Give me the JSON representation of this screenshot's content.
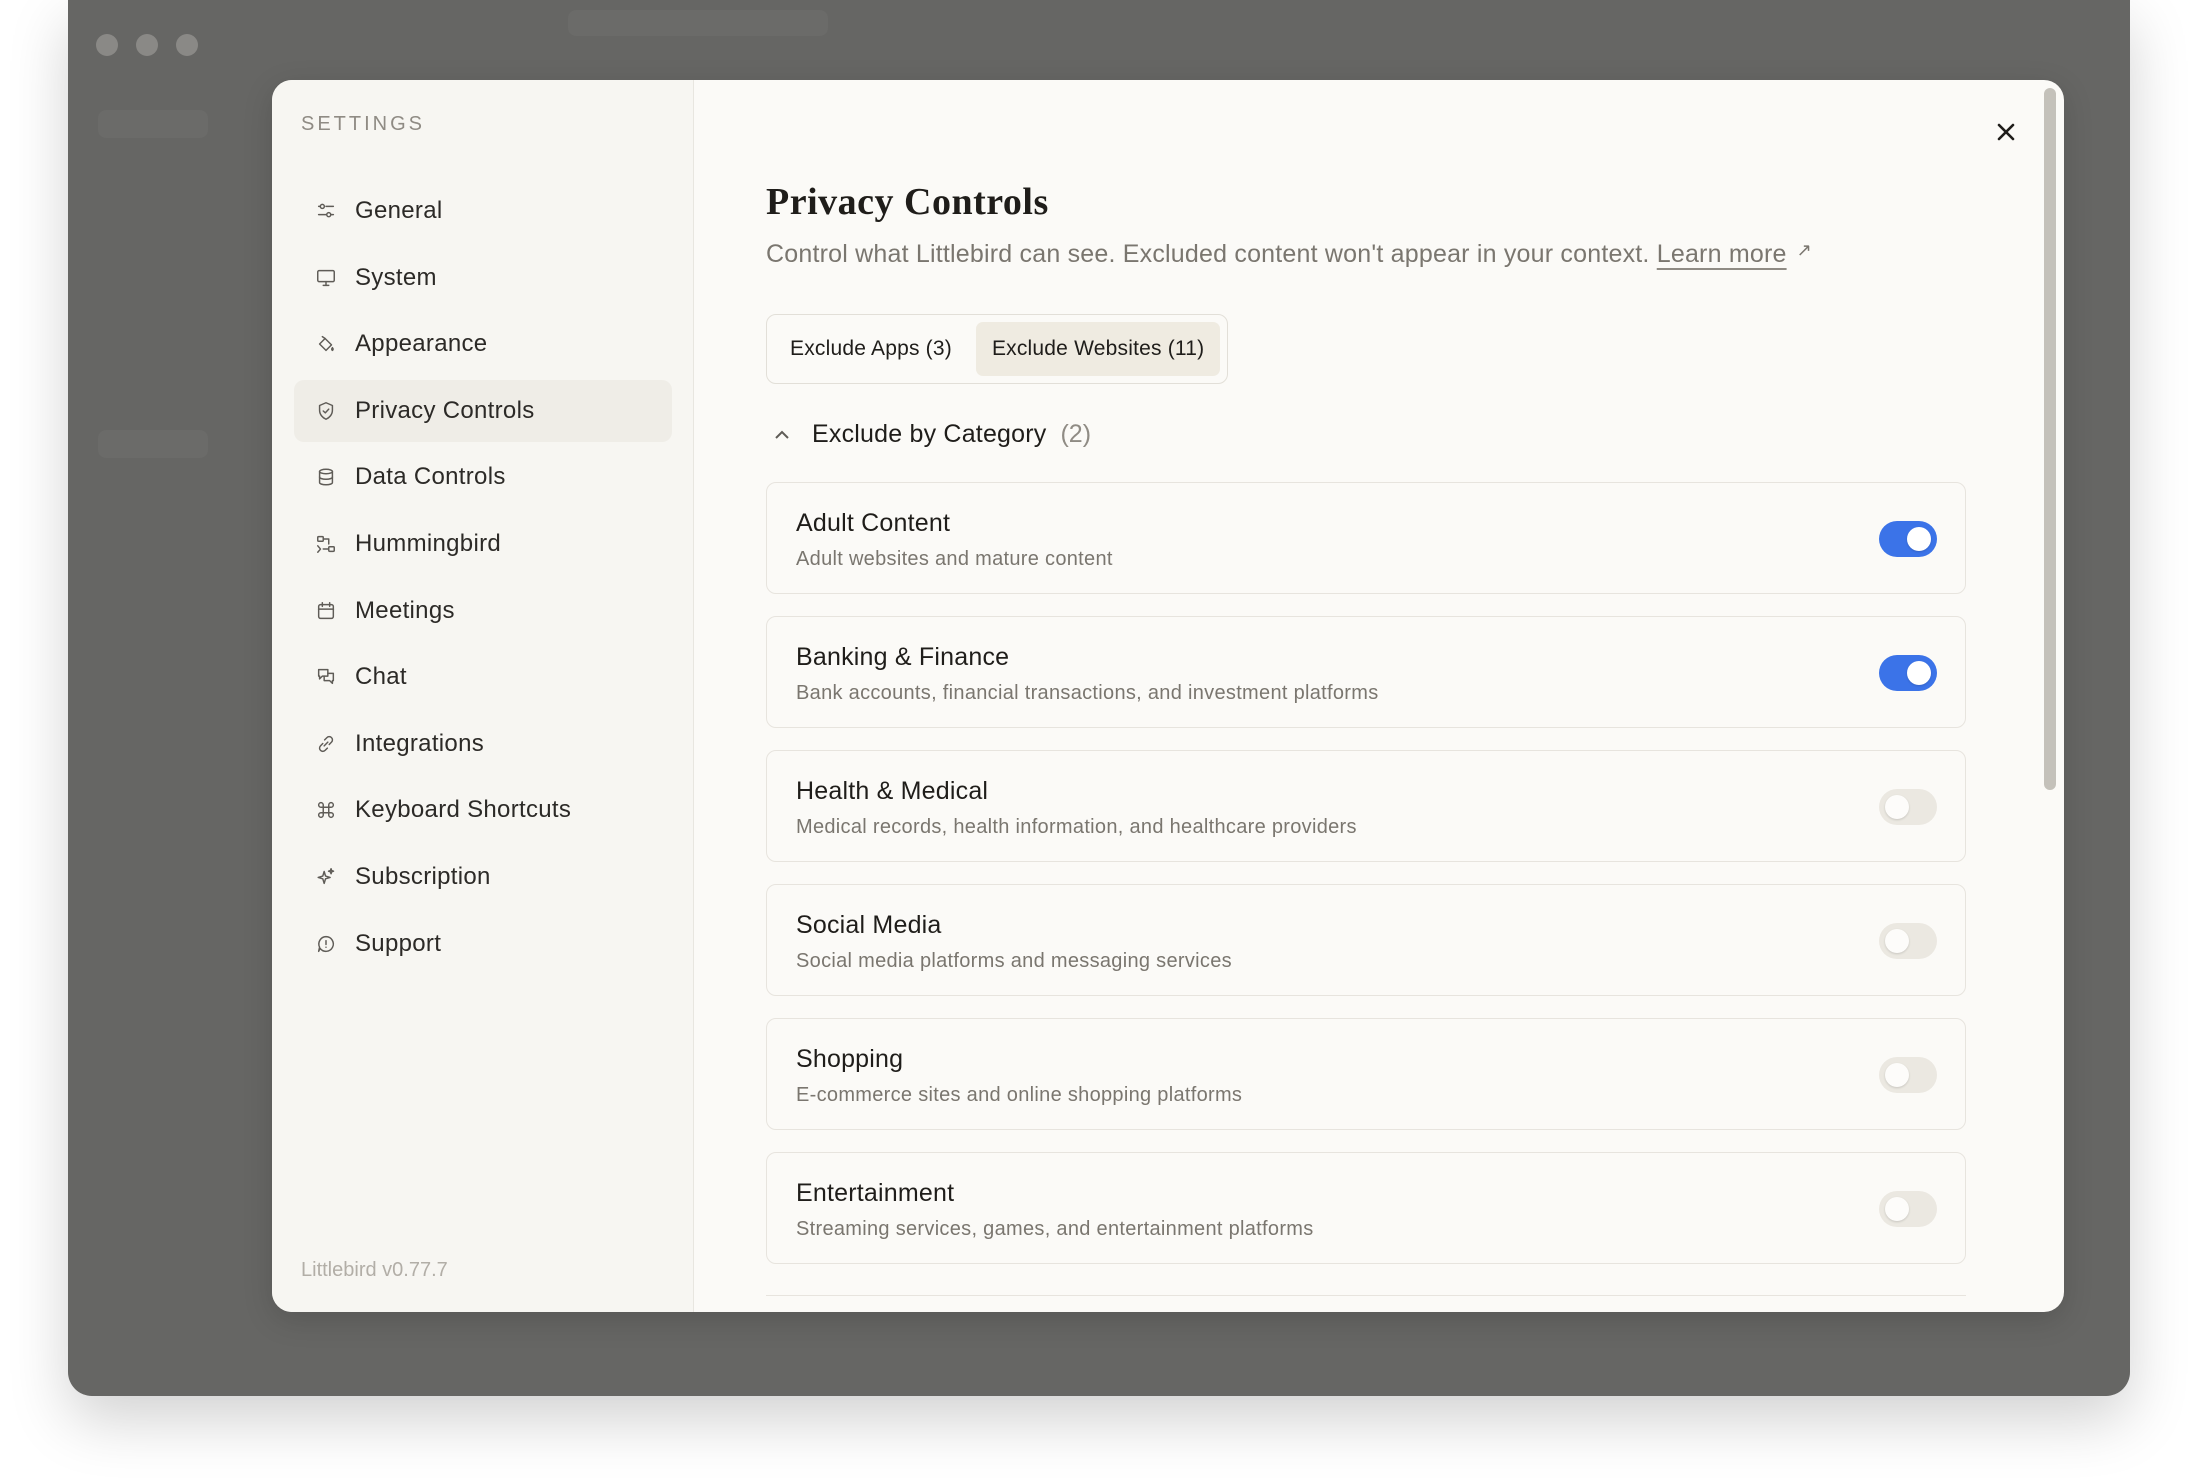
{
  "colors": {
    "accent": "#3b73e8",
    "toggle_off": "#ebe8e1",
    "active_nav_bg": "#efede7",
    "active_tab_bg": "#efebe1"
  },
  "sidebar": {
    "heading": "SETTINGS",
    "items": [
      {
        "label": "General",
        "icon": "sliders-icon"
      },
      {
        "label": "System",
        "icon": "monitor-icon"
      },
      {
        "label": "Appearance",
        "icon": "paint-bucket-icon"
      },
      {
        "label": "Privacy Controls",
        "icon": "shield-icon",
        "active": true
      },
      {
        "label": "Data Controls",
        "icon": "database-icon"
      },
      {
        "label": "Hummingbird",
        "icon": "workflow-icon"
      },
      {
        "label": "Meetings",
        "icon": "calendar-icon"
      },
      {
        "label": "Chat",
        "icon": "chat-bubbles-icon"
      },
      {
        "label": "Integrations",
        "icon": "link-icon"
      },
      {
        "label": "Keyboard Shortcuts",
        "icon": "command-icon"
      },
      {
        "label": "Subscription",
        "icon": "sparkles-icon"
      },
      {
        "label": "Support",
        "icon": "alert-bubble-icon"
      }
    ],
    "version": "Littlebird v0.77.7"
  },
  "main": {
    "title": "Privacy Controls",
    "description": "Control what Littlebird can see. Excluded content won't appear in your context.",
    "learn_more": "Learn more",
    "tabs": [
      {
        "label": "Exclude Apps (3)",
        "active": false
      },
      {
        "label": "Exclude Websites (11)",
        "active": true
      }
    ],
    "category_section": {
      "title": "Exclude by Category",
      "count": "(2)",
      "expanded": true
    },
    "categories": [
      {
        "title": "Adult Content",
        "description": "Adult websites and mature content",
        "enabled": true
      },
      {
        "title": "Banking & Finance",
        "description": "Bank accounts, financial transactions, and investment platforms",
        "enabled": true
      },
      {
        "title": "Health & Medical",
        "description": "Medical records, health information, and healthcare providers",
        "enabled": false
      },
      {
        "title": "Social Media",
        "description": "Social media platforms and messaging services",
        "enabled": false
      },
      {
        "title": "Shopping",
        "description": "E-commerce sites and online shopping platforms",
        "enabled": false
      },
      {
        "title": "Entertainment",
        "description": "Streaming services, games, and entertainment platforms",
        "enabled": false
      }
    ]
  }
}
